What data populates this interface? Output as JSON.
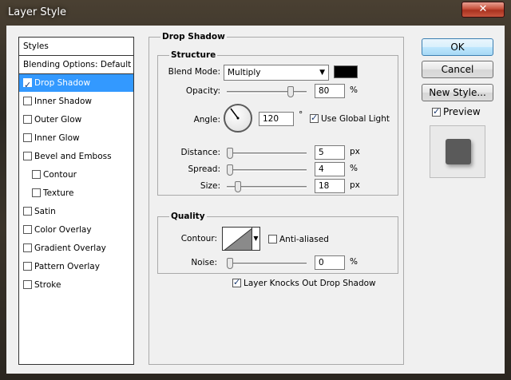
{
  "window": {
    "title": "Layer Style",
    "close_glyph": "✕"
  },
  "styles_list": {
    "header": "Styles",
    "blending": "Blending Options: Default",
    "items": [
      {
        "label": "Drop Shadow",
        "checked": true,
        "selected": true
      },
      {
        "label": "Inner Shadow",
        "checked": false
      },
      {
        "label": "Outer Glow",
        "checked": false
      },
      {
        "label": "Inner Glow",
        "checked": false
      },
      {
        "label": "Bevel and Emboss",
        "checked": false
      },
      {
        "label": "Contour",
        "checked": false
      },
      {
        "label": "Texture",
        "checked": false
      },
      {
        "label": "Satin",
        "checked": false
      },
      {
        "label": "Color Overlay",
        "checked": false
      },
      {
        "label": "Gradient Overlay",
        "checked": false
      },
      {
        "label": "Pattern Overlay",
        "checked": false
      },
      {
        "label": "Stroke",
        "checked": false
      }
    ]
  },
  "drop_shadow": {
    "title": "Drop Shadow",
    "structure": {
      "title": "Structure",
      "blend_mode_label": "Blend Mode:",
      "blend_mode_value": "Multiply",
      "shadow_color": "#000000",
      "opacity_label": "Opacity:",
      "opacity_value": "80",
      "opacity_unit": "%",
      "angle_label": "Angle:",
      "angle_value": "120",
      "angle_unit": "°",
      "global_light_label": "Use Global Light",
      "global_light_checked": true,
      "distance_label": "Distance:",
      "distance_value": "5",
      "distance_unit": "px",
      "spread_label": "Spread:",
      "spread_value": "4",
      "spread_unit": "%",
      "size_label": "Size:",
      "size_value": "18",
      "size_unit": "px"
    },
    "quality": {
      "title": "Quality",
      "contour_label": "Contour:",
      "anti_aliased_label": "Anti-aliased",
      "anti_aliased_checked": false,
      "noise_label": "Noise:",
      "noise_value": "0",
      "noise_unit": "%"
    },
    "knockout_label": "Layer Knocks Out Drop Shadow",
    "knockout_checked": true
  },
  "buttons": {
    "ok": "OK",
    "cancel": "Cancel",
    "new_style": "New Style...",
    "preview_label": "Preview",
    "preview_checked": true
  },
  "colors": {
    "selection": "#3399ff",
    "dialog_bg": "#f0f0f0",
    "close_red": "#c7503b"
  }
}
